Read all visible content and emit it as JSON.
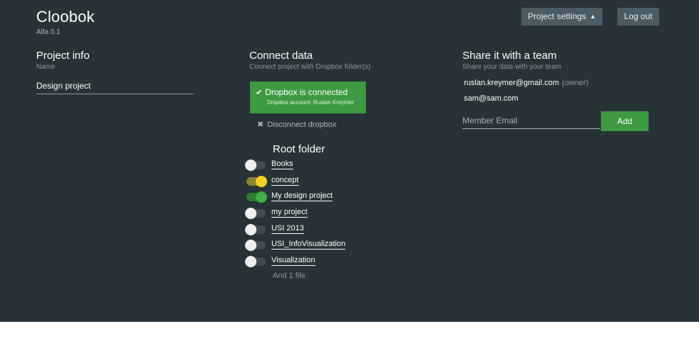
{
  "brand": {
    "title": "Cloobok",
    "version": "Alfa 0.1"
  },
  "header": {
    "settings_label": "Project settings",
    "settings_icon": "chevron-up-icon",
    "logout_label": "Log out"
  },
  "project_info": {
    "title": "Project info",
    "subtitle": "Name",
    "name_value": "Design project"
  },
  "connect": {
    "title": "Connect data",
    "subtitle": "Connect project with Dropbox folder(s)",
    "status": "Dropbox is connected",
    "account": "Dropbox account: Ruslan Kreymer",
    "disconnect_label": "Disconnect dropbox",
    "root_title": "Root folder",
    "folders": [
      {
        "label": "Books",
        "state": "off"
      },
      {
        "label": "concept",
        "state": "on-yellow"
      },
      {
        "label": "My design project",
        "state": "on-green"
      },
      {
        "label": "my project",
        "state": "off"
      },
      {
        "label": "USI 2013",
        "state": "off"
      },
      {
        "label": "USI_InfoVisualization",
        "state": "off"
      },
      {
        "label": "Visualization",
        "state": "off"
      }
    ],
    "more_files": "And 1 file"
  },
  "share": {
    "title": "Share it with a team",
    "subtitle": "Share your data with your team",
    "members": [
      {
        "email": "ruslan.kreymer@gmail.com",
        "role": "(owner)"
      },
      {
        "email": "sam@sam.com",
        "role": ""
      }
    ],
    "email_placeholder": "Member Email",
    "add_label": "Add"
  },
  "colors": {
    "background": "#283337",
    "accent_green": "#3d9a42",
    "toggle_yellow": "#f5d020",
    "button_gray": "#4a5b63"
  }
}
